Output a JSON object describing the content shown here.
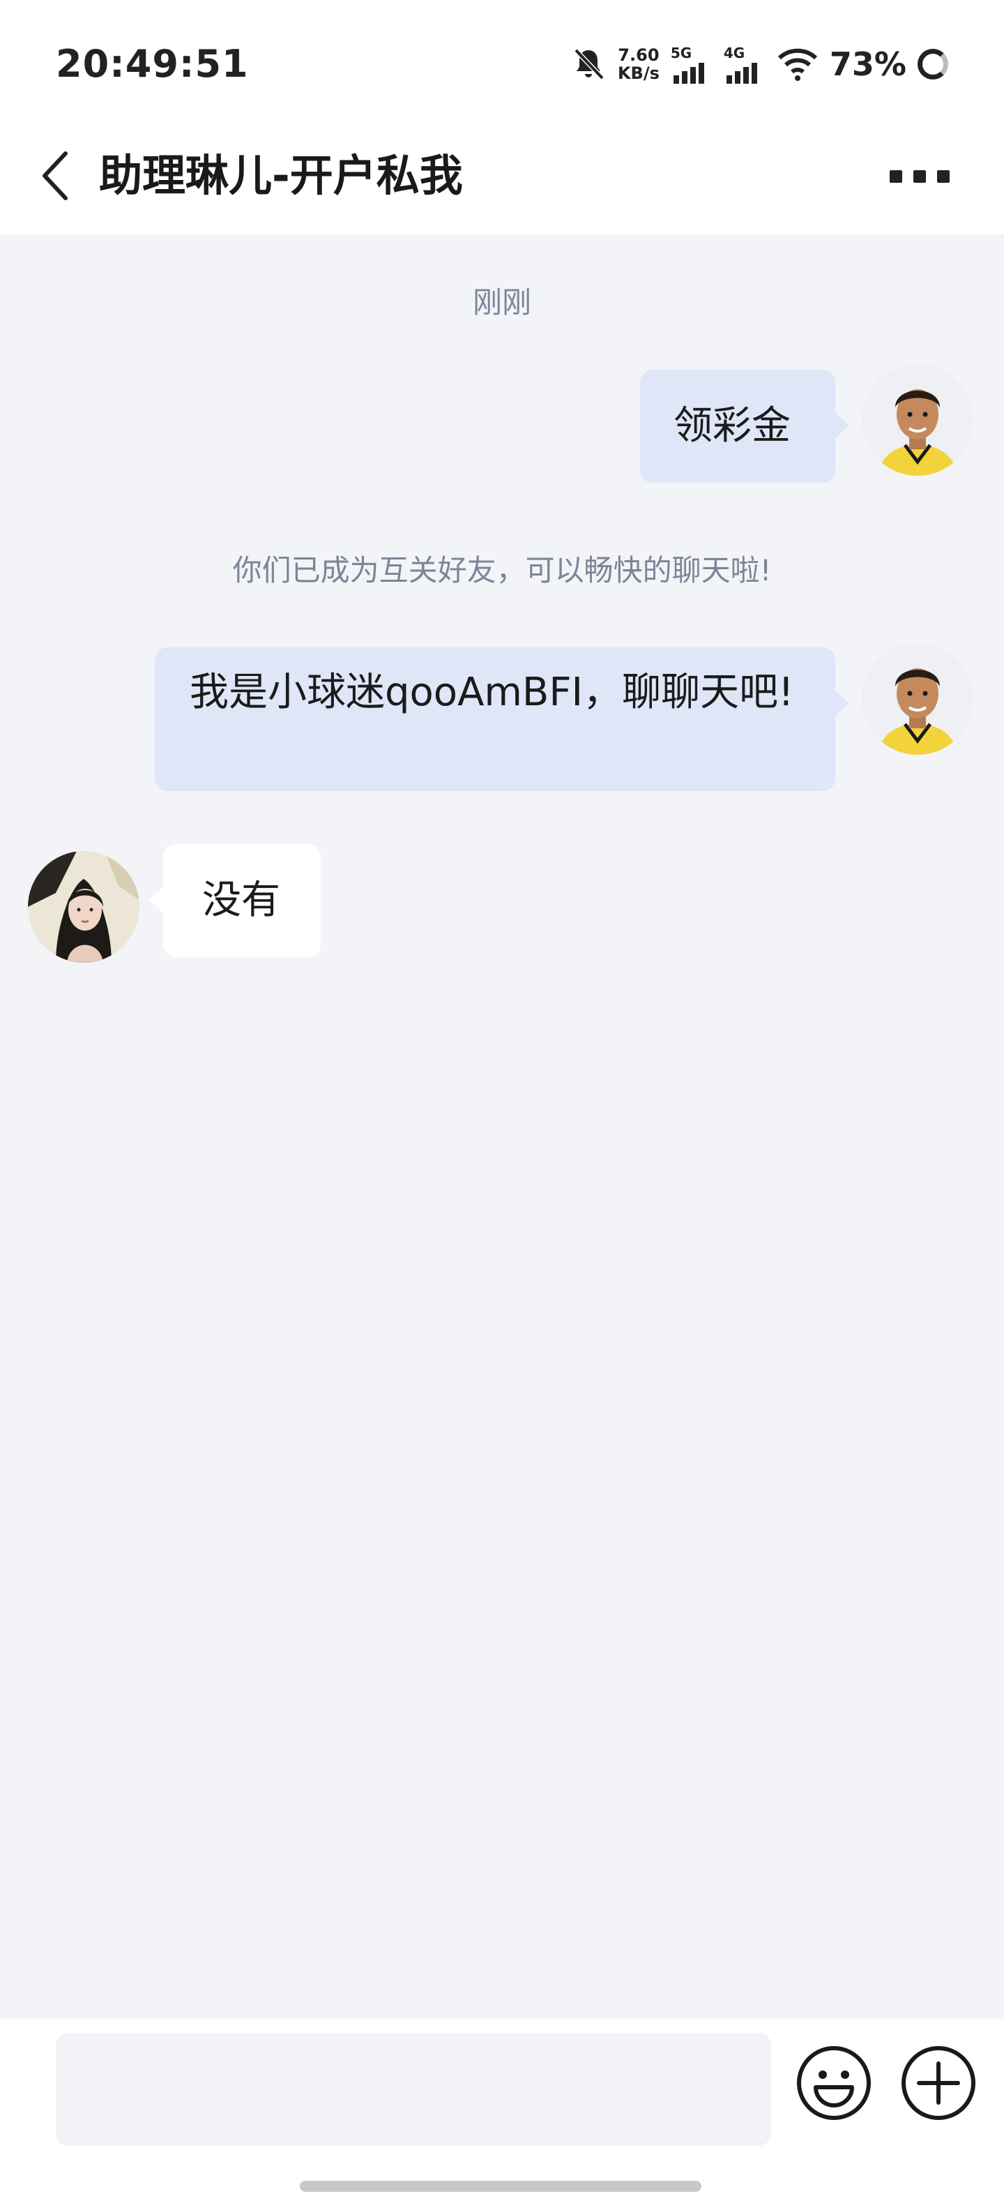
{
  "status_bar": {
    "time": "20:49:51",
    "net_speed_value": "7.60",
    "net_speed_unit": "KB/s",
    "sim1_label": "5G",
    "sim2_label": "4G",
    "battery": "73%"
  },
  "header": {
    "title": "助理琳儿-开户私我"
  },
  "chat": {
    "timestamp": "刚刚",
    "messages": [
      {
        "side": "me",
        "text": "领彩金"
      },
      {
        "side": "system",
        "text": "你们已成为互关好友，可以畅快的聊天啦!"
      },
      {
        "side": "me",
        "text": "我是小球迷qooAmBFI，聊聊天吧!"
      },
      {
        "side": "other",
        "text": "没有"
      }
    ]
  },
  "composer": {
    "input_value": "",
    "input_placeholder": ""
  },
  "icons": [
    "mute-bell-icon",
    "signal-icon",
    "wifi-icon",
    "battery-icon",
    "back-arrow-icon",
    "more-icon",
    "emoji-icon",
    "plus-icon"
  ]
}
